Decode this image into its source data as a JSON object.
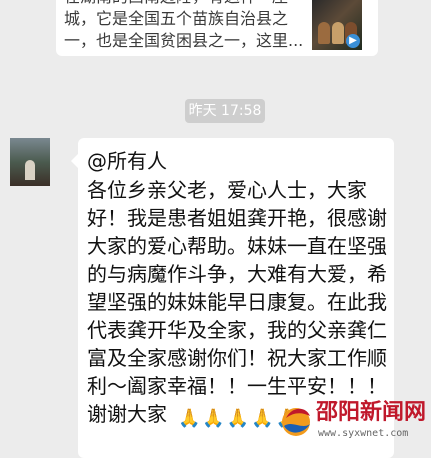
{
  "shared_card": {
    "text": "在湖南的西南边陲，有这样一座\n城，它是全国五个苗族自治县之\n一，也是全国贫困县之一，这里...",
    "thumbnail_icon": "video-thumbnail",
    "badge_icon": "play-badge-icon"
  },
  "timestamp": "昨天 17:58",
  "message": {
    "mention": "@所有人",
    "body": "各位乡亲父老，爱心人士，大家\n好！我是患者姐姐龚开艳，很感谢\n大家的爱心帮助。妹妹一直在坚强\n的与病魔作斗争，大难有大爱，希\n望坚强的妹妹能早日康复。在此我\n代表龚开华及全家，我的父亲龚仁\n富及全家感谢你们！祝大家工作顺\n利～阖家幸福！！一生平安！！！\n谢谢大家",
    "emojis": "🙏🙏🙏🙏🙏"
  },
  "watermark": {
    "title": "邵阳新闻网",
    "url": "www.syxwnet.com"
  },
  "colors": {
    "background": "#ececec",
    "bubble": "#ffffff",
    "timestamp_bg": "#cecece",
    "watermark_red": "#c0182b"
  }
}
